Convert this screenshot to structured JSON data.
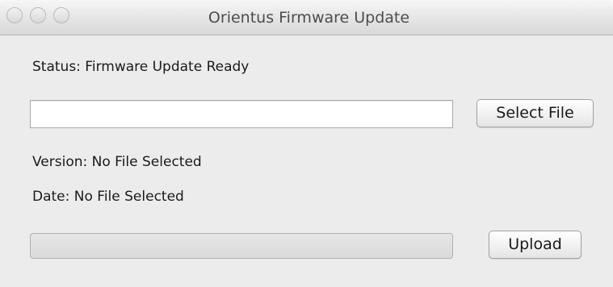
{
  "window": {
    "title": "Orientus Firmware Update",
    "controls": [
      "close",
      "minimize",
      "zoom"
    ]
  },
  "status": {
    "text": "Status: Firmware Update Ready"
  },
  "file": {
    "path_value": "",
    "select_button_label": "Select File"
  },
  "info": {
    "version_text": "Version: No File Selected",
    "date_text": "Date: No File Selected"
  },
  "upload": {
    "progress_fraction": 0,
    "button_label": "Upload"
  },
  "colors": {
    "window_background": "#ececec",
    "text": "#1a1a1a",
    "title_text": "#4d4d4d",
    "progress_track": "#dadada"
  }
}
